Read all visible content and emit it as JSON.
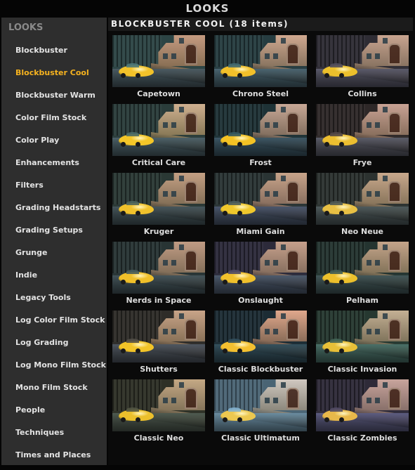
{
  "window": {
    "title": "LOOKS"
  },
  "sidebar": {
    "header": "LOOKS",
    "selected_index": 1,
    "accent_color": "#f5b21f",
    "items": [
      {
        "label": "Blockbuster"
      },
      {
        "label": "Blockbuster Cool"
      },
      {
        "label": "Blockbuster Warm"
      },
      {
        "label": "Color Film Stock"
      },
      {
        "label": "Color Play"
      },
      {
        "label": "Enhancements"
      },
      {
        "label": "Filters"
      },
      {
        "label": "Grading Headstarts"
      },
      {
        "label": "Grading Setups"
      },
      {
        "label": "Grunge"
      },
      {
        "label": "Indie"
      },
      {
        "label": "Legacy Tools"
      },
      {
        "label": "Log Color Film Stock"
      },
      {
        "label": "Log Grading"
      },
      {
        "label": "Log Mono Film Stock"
      },
      {
        "label": "Mono Film Stock"
      },
      {
        "label": "People"
      },
      {
        "label": "Techniques"
      },
      {
        "label": "Times and Places"
      }
    ]
  },
  "main": {
    "title": "BLOCKBUSTER COOL (18 items)",
    "looks": [
      {
        "label": "Capetown",
        "tint": {
          "sky": "#2c4444",
          "house": "#c49a80",
          "ground": "#4a5a62",
          "car": "#f2c22a",
          "wall": "#8a7055"
        }
      },
      {
        "label": "Chrono Steel",
        "tint": {
          "sky": "#263c40",
          "house": "#d0a890",
          "ground": "#4a6470",
          "car": "#f2c02a",
          "wall": "#8a7560"
        }
      },
      {
        "label": "Collins",
        "tint": {
          "sky": "#2e2c34",
          "house": "#c8a490",
          "ground": "#5a5a6a",
          "car": "#ecc02c",
          "wall": "#8a7462"
        }
      },
      {
        "label": "Critical Care",
        "tint": {
          "sky": "#2a3c3a",
          "house": "#cfb090",
          "ground": "#4c6068",
          "car": "#f4c628",
          "wall": "#8a7a58"
        }
      },
      {
        "label": "Frost",
        "tint": {
          "sky": "#1e3236",
          "house": "#c8a896",
          "ground": "#3c5664",
          "car": "#f4c224",
          "wall": "#847060"
        }
      },
      {
        "label": "Frye",
        "tint": {
          "sky": "#2e2828",
          "house": "#c8a294",
          "ground": "#5a5c68",
          "car": "#ecbe30",
          "wall": "#8a705e"
        }
      },
      {
        "label": "Kruger",
        "tint": {
          "sky": "#2a3834",
          "house": "#c4a084",
          "ground": "#46565c",
          "car": "#f0c22c",
          "wall": "#857058"
        }
      },
      {
        "label": "Miami Gain",
        "tint": {
          "sky": "#2a3434",
          "house": "#c8a48a",
          "ground": "#4a566c",
          "car": "#f0c82c",
          "wall": "#8a7060"
        }
      },
      {
        "label": "Neo Neue",
        "tint": {
          "sky": "#2c3230",
          "house": "#c8a88c",
          "ground": "#4e5a5c",
          "car": "#e8c044",
          "wall": "#8a765c"
        }
      },
      {
        "label": "Nerds in Space",
        "tint": {
          "sky": "#283434",
          "house": "#c09c84",
          "ground": "#44545a",
          "car": "#f0c02a",
          "wall": "#84705a"
        }
      },
      {
        "label": "Onslaught",
        "tint": {
          "sky": "#2c2a3a",
          "house": "#c6a08c",
          "ground": "#4c5a6c",
          "car": "#f0c02c",
          "wall": "#887060"
        }
      },
      {
        "label": "Pelham",
        "tint": {
          "sky": "#243430",
          "house": "#c4a48a",
          "ground": "#425658",
          "car": "#ecc02c",
          "wall": "#84745a"
        }
      },
      {
        "label": "Shutters",
        "tint": {
          "sky": "#2e2c28",
          "house": "#c8a488",
          "ground": "#4e5660",
          "car": "#f2c428",
          "wall": "#8a7258"
        }
      },
      {
        "label": "Classic Blockbuster",
        "tint": {
          "sky": "#1c2c34",
          "house": "#e0a88c",
          "ground": "#34505c",
          "car": "#f4c030",
          "wall": "#8a6c58"
        }
      },
      {
        "label": "Classic Invasion",
        "tint": {
          "sky": "#263830",
          "house": "#c4b094",
          "ground": "#4a7068",
          "car": "#e8c038",
          "wall": "#80745c"
        }
      },
      {
        "label": "Classic Neo",
        "tint": {
          "sky": "#2e3026",
          "house": "#c4a884",
          "ground": "#4e5a50",
          "car": "#ecc02c",
          "wall": "#84745a"
        }
      },
      {
        "label": "Classic Ultimatum",
        "tint": {
          "sky": "#4a6474",
          "house": "#d0c8c0",
          "ground": "#6a8ca0",
          "car": "#ecc850",
          "wall": "#8c887c"
        }
      },
      {
        "label": "Classic Zombies",
        "tint": {
          "sky": "#2e2a38",
          "house": "#c8a49c",
          "ground": "#5c5c80",
          "car": "#e8b84a",
          "wall": "#88706a"
        }
      }
    ]
  }
}
